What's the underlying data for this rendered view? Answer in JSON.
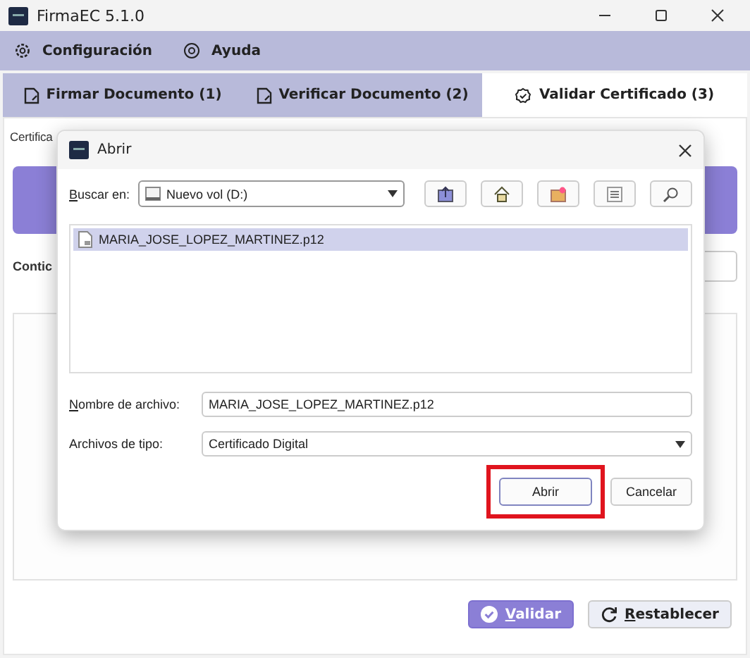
{
  "window": {
    "title": "FirmaEC 5.1.0"
  },
  "menu": [
    {
      "label": "Configuración"
    },
    {
      "label": "Ayuda"
    }
  ],
  "tabs": [
    {
      "label": "Firmar Documento (1)",
      "selected": false
    },
    {
      "label": "Verificar Documento (2)",
      "selected": false
    },
    {
      "label": "Validar Certificado (3)",
      "selected": true
    }
  ],
  "form": {
    "certificate_label": "Certifica",
    "password_label": "Contic"
  },
  "actions": [
    {
      "label": "Validar",
      "kind": "primary"
    },
    {
      "label": "Restablecer",
      "kind": "secondary"
    }
  ],
  "dialog": {
    "title": "Abrir",
    "look_in": {
      "label": "Buscar en:",
      "value": "Nuevo vol (D:)"
    },
    "files": [
      {
        "name": "MARIA_JOSE_LOPEZ_MARTINEZ.p12",
        "selected": true
      }
    ],
    "file_name": {
      "label": "Nombre de archivo:",
      "value": "MARIA_JOSE_LOPEZ_MARTINEZ.p12"
    },
    "file_type": {
      "label": "Archivos de tipo:",
      "value": "Certificado Digital"
    },
    "buttons": [
      {
        "label": "Abrir",
        "highlighted": true
      },
      {
        "label": "Cancelar",
        "highlighted": false
      }
    ]
  }
}
